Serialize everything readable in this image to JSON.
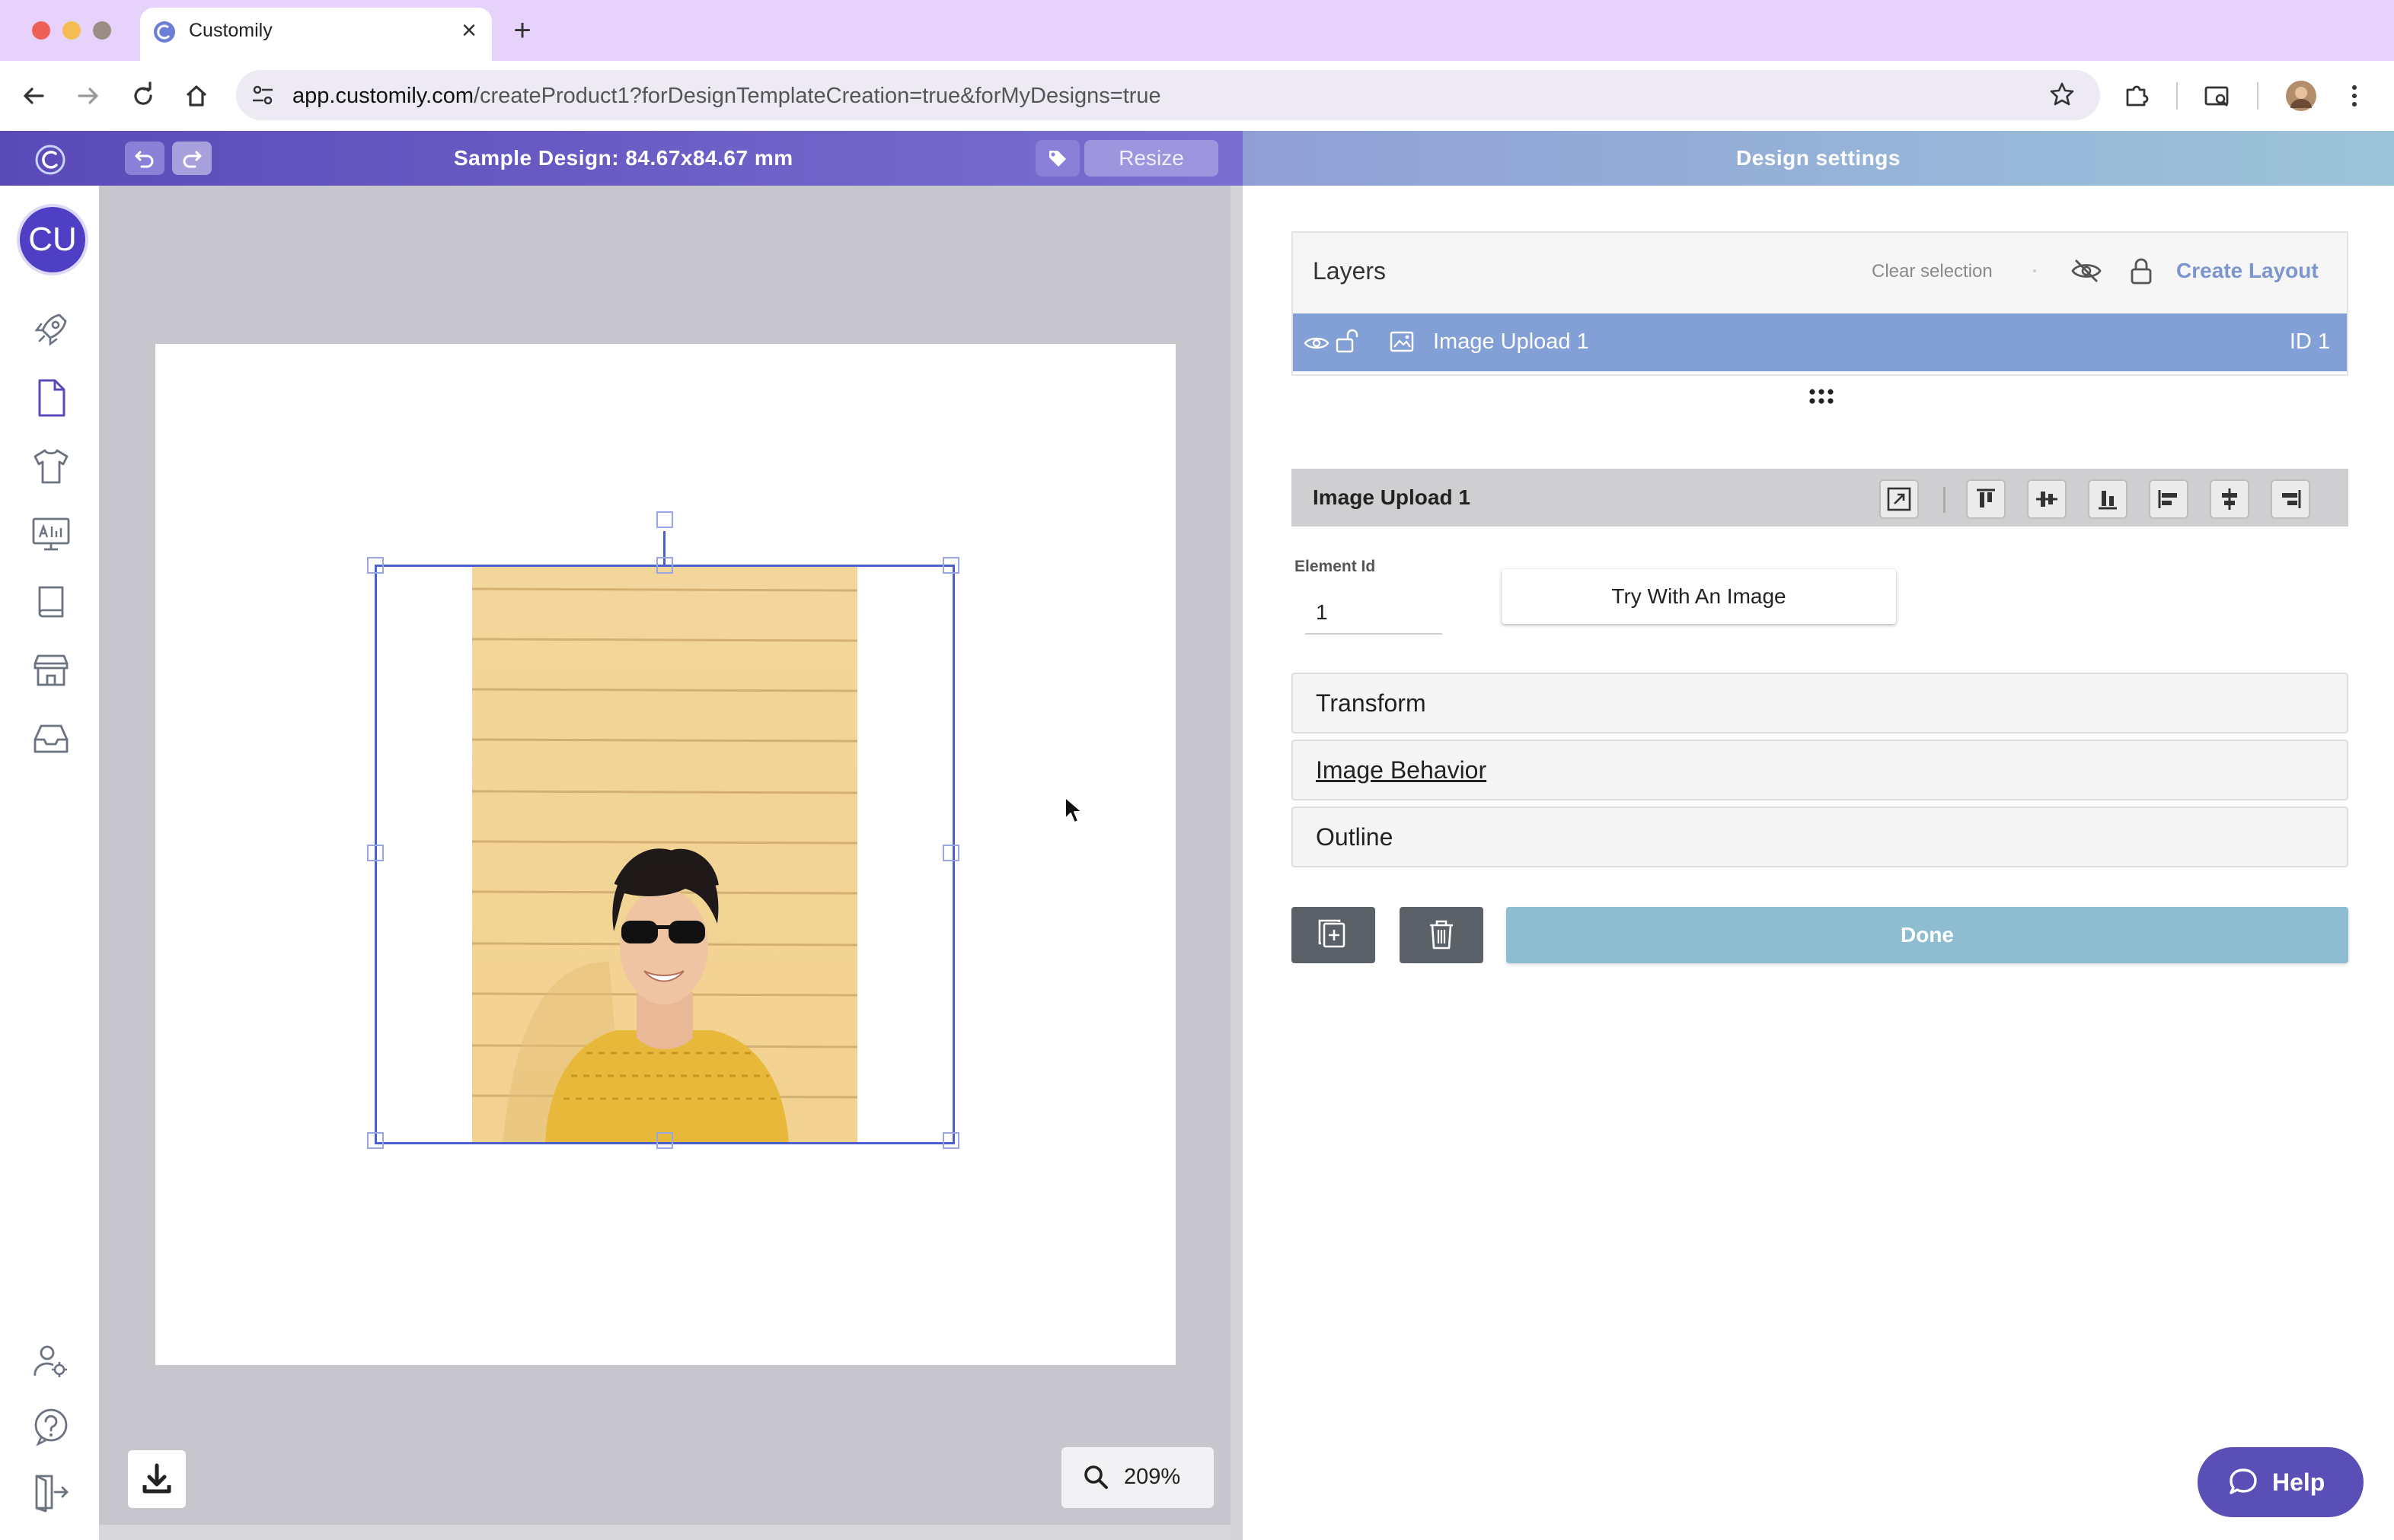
{
  "browser": {
    "tab_title": "Customily",
    "tab_close": "×",
    "new_tab": "+",
    "url_host": "app.customily.com",
    "url_path": "/createProduct1?forDesignTemplateCreation=true&forMyDesigns=true"
  },
  "app_bar": {
    "design_title": "Sample Design: 84.67x84.67 mm",
    "resize_label": "Resize",
    "settings_title": "Design settings"
  },
  "sidebar": {
    "avatar_initials": "CU"
  },
  "canvas": {
    "zoom_level": "209%"
  },
  "layers": {
    "title": "Layers",
    "clear_selection": "Clear selection",
    "create_layout": "Create Layout",
    "items": [
      {
        "name": "Image Upload 1",
        "id_label": "ID 1"
      }
    ]
  },
  "element": {
    "title": "Image Upload 1",
    "element_id_label": "Element Id",
    "element_id_value": "1",
    "try_button": "Try With An Image",
    "sections": {
      "transform": "Transform",
      "image_behavior": "Image Behavior",
      "outline": "Outline"
    },
    "done_label": "Done"
  },
  "help": {
    "label": "Help"
  },
  "colors": {
    "brand_purple": "#5a4ab8",
    "selection_blue": "#4a5fd0",
    "layer_row": "#82a0d6",
    "done_button": "#8ebcd0"
  }
}
